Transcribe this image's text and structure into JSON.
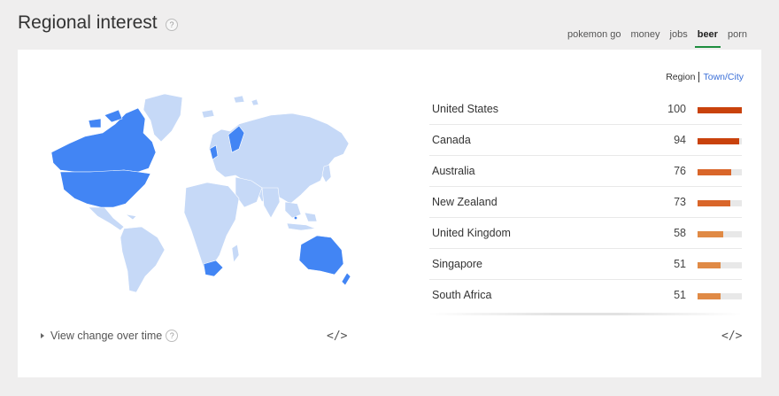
{
  "header": {
    "title": "Regional interest",
    "help": "?"
  },
  "tabs": [
    {
      "label": "pokemon go",
      "active": false
    },
    {
      "label": "money",
      "active": false
    },
    {
      "label": "jobs",
      "active": false
    },
    {
      "label": "beer",
      "active": true
    },
    {
      "label": "porn",
      "active": false
    }
  ],
  "toggle": {
    "region": "Region",
    "town": "Town/City"
  },
  "regions": [
    {
      "name": "United States",
      "value": 100
    },
    {
      "name": "Canada",
      "value": 94
    },
    {
      "name": "Australia",
      "value": 76
    },
    {
      "name": "New Zealand",
      "value": 73
    },
    {
      "name": "United Kingdom",
      "value": 58
    },
    {
      "name": "Singapore",
      "value": 51
    },
    {
      "name": "South Africa",
      "value": 51
    }
  ],
  "footer": {
    "view_change": "View change over time",
    "help": "?",
    "embed_left": "</>",
    "embed_right": "</>"
  },
  "colors": {
    "map_high": "#4285f4",
    "map_low": "#c6d9f7",
    "bar_high": "#c9420c",
    "bar_mid": "#d9662a",
    "bar_low": "#e08a45",
    "tab_active": "#1e8e3e",
    "link": "#3a6fd8"
  }
}
